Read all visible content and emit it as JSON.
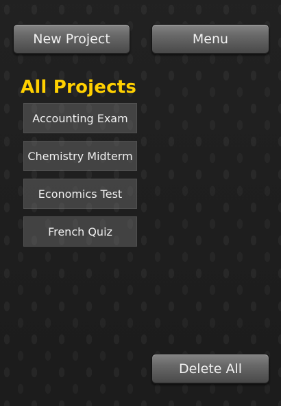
{
  "toolbar": {
    "new_project_label": "New Project",
    "menu_label": "Menu"
  },
  "projects_section": {
    "title": "All Projects",
    "items": [
      {
        "label": "Accounting Exam"
      },
      {
        "label": "Chemistry Midterm"
      },
      {
        "label": "Economics Test"
      },
      {
        "label": "French Quiz"
      }
    ]
  },
  "footer": {
    "delete_all_label": "Delete All"
  },
  "colors": {
    "title_accent": "#ffd000"
  }
}
